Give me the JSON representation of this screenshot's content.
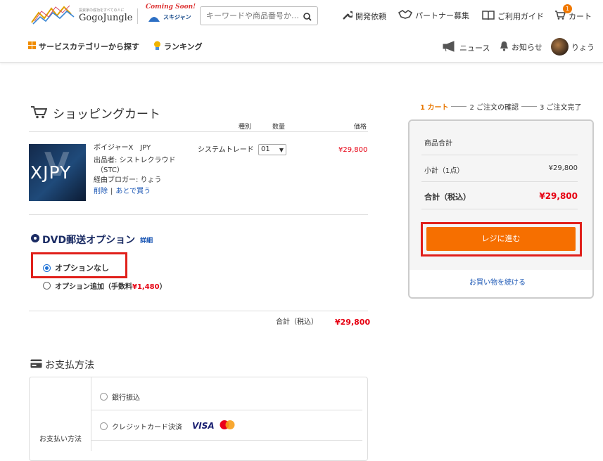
{
  "header": {
    "logo_tagline": "投資家の成功をすべての人に",
    "logo_name": "GogoJungle",
    "coming_soon": "Coming Soon!",
    "sukijan": "スキジャン",
    "search_placeholder": "キーワードや商品番号か…",
    "nav": [
      "開発依頼",
      "パートナー募集",
      "ご利用ガイド",
      "カート"
    ],
    "cart_count": "1",
    "subnav_left": [
      "サービスカテゴリーから探す",
      "ランキング"
    ],
    "subnav_right": [
      "ニュース",
      "お知らせ",
      "りょう"
    ]
  },
  "cart": {
    "title": "ショッピングカート",
    "columns": [
      "種別",
      "数量",
      "価格"
    ],
    "item": {
      "name": "ボイジャーX　JPY",
      "image_text": "XJPY",
      "seller": "出品者: シストレクラウド",
      "seller2": "（STC）",
      "via": "経由ブロガー: りょう",
      "delete": "削除",
      "later": "あとで買う",
      "type": "システムトレード",
      "qty": "01",
      "price": "¥29,800"
    },
    "dvd": {
      "title": "DVD郵送オプション",
      "detail": "詳細",
      "opt_none": "オプションなし",
      "opt_add": "オプション追加（手数料",
      "opt_add_price": "¥1,480",
      "opt_add_end": "）"
    },
    "total_label": "合計（税込）",
    "total_value": "¥29,800"
  },
  "payment": {
    "title": "お支払方法",
    "label": "お支払い方法",
    "options": [
      "銀行振込",
      "クレジットカード決済"
    ],
    "visa": "VISA"
  },
  "steps": [
    "1 カート",
    "2 ご注文の確認",
    "3 ご注文完了"
  ],
  "summary": {
    "title": "商品合計",
    "subtotal_label": "小計（1点）",
    "subtotal_value": "¥29,800",
    "total_label": "合計（税込）",
    "total_value": "¥29,800",
    "checkout": "レジに進む",
    "continue": "お買い物を続ける"
  }
}
